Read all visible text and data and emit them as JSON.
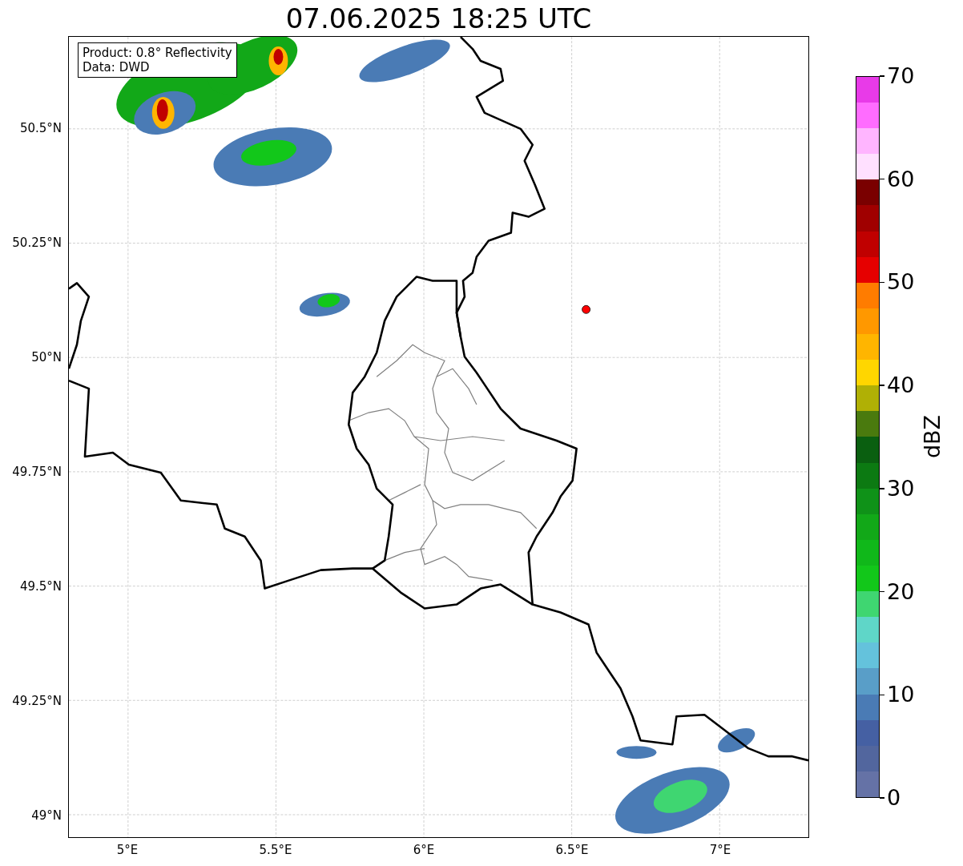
{
  "title": "07.06.2025 18:25 UTC",
  "annotation": {
    "lines": [
      "Product: 0.8° Reflectivity",
      "Data: DWD"
    ]
  },
  "map": {
    "lon_labels": [
      "5°E",
      "5.5°E",
      "6°E",
      "6.5°E",
      "7°E"
    ],
    "lat_labels": [
      "50.5°N",
      "50.25°N",
      "50°N",
      "49.75°N",
      "49.5°N",
      "49.25°N",
      "49°N"
    ]
  },
  "colorbar": {
    "label": "dBZ",
    "ticks": [
      "70",
      "60",
      "50",
      "40",
      "30",
      "20",
      "10",
      "0"
    ],
    "bins": [
      {
        "color": "#6572a6"
      },
      {
        "color": "#52669e"
      },
      {
        "color": "#4560a3"
      },
      {
        "color": "#4a7bb5"
      },
      {
        "color": "#599ec8"
      },
      {
        "color": "#64c2dc"
      },
      {
        "color": "#5fd6c8"
      },
      {
        "color": "#3fd671"
      },
      {
        "color": "#12c71a"
      },
      {
        "color": "#10b81a"
      },
      {
        "color": "#12a818"
      },
      {
        "color": "#0f9218"
      },
      {
        "color": "#0c7a12"
      },
      {
        "color": "#0a5f10"
      },
      {
        "color": "#4a7a0e"
      },
      {
        "color": "#b0b005"
      },
      {
        "color": "#ffd600"
      },
      {
        "color": "#ffb500"
      },
      {
        "color": "#ff9800"
      },
      {
        "color": "#ff7c00"
      },
      {
        "color": "#e60000"
      },
      {
        "color": "#c00000"
      },
      {
        "color": "#a00000"
      },
      {
        "color": "#7a0000"
      },
      {
        "color": "#ffe0ff"
      },
      {
        "color": "#ffb5ff"
      },
      {
        "color": "#ff6cff"
      },
      {
        "color": "#e83ae8"
      }
    ]
  }
}
